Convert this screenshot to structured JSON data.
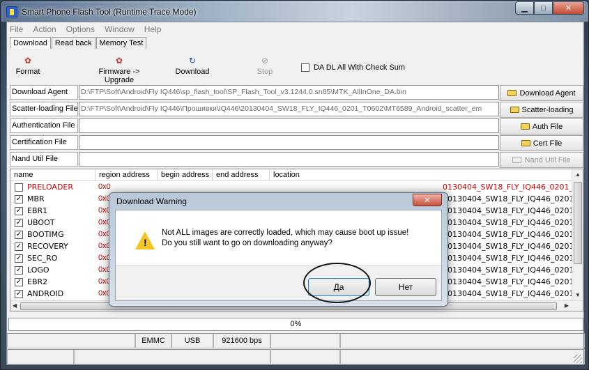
{
  "window": {
    "title": "Smart Phone Flash Tool (Runtime Trace Mode)"
  },
  "menu": [
    "File",
    "Action",
    "Options",
    "Window",
    "Help"
  ],
  "tabs": [
    "Download",
    "Read back",
    "Memory Test"
  ],
  "toolbar": {
    "format": "Format",
    "firmware_upgrade": "Firmware -> Upgrade",
    "download": "Download",
    "stop": "Stop",
    "checksum": "DA DL All With Check Sum"
  },
  "fields": [
    {
      "label": "Download Agent",
      "value": "D:\\FTP\\Soft\\Android\\Fly IQ446\\sp_flash_tool\\SP_Flash_Tool_v3.1244.0.sn85\\MTK_AllInOne_DA.bin",
      "button": "Download Agent"
    },
    {
      "label": "Scatter-loading File",
      "value": "D:\\FTP\\Soft\\Android\\Fly IQ446\\Прошивки\\IQ446\\20130404_SW18_FLY_IQ446_0201_T0602\\MT6589_Android_scatter_em",
      "button": "Scatter-loading"
    },
    {
      "label": "Authentication File",
      "value": "",
      "button": "Auth File"
    },
    {
      "label": "Certification File",
      "value": "",
      "button": "Cert File"
    },
    {
      "label": "Nand Util File",
      "value": "",
      "button": "Nand Util File"
    }
  ],
  "table": {
    "columns": [
      "name",
      "region address",
      "begin address",
      "end address",
      "location"
    ],
    "rows": [
      {
        "name": "PRELOADER",
        "checked": false,
        "region": "0x0",
        "location": "0130404_SW18_FLY_IQ446_0201_"
      },
      {
        "name": "MBR",
        "checked": true,
        "region": "0x0",
        "location": "20130404_SW18_FLY_IQ446_0201_"
      },
      {
        "name": "EBR1",
        "checked": true,
        "region": "0x0",
        "location": "20130404_SW18_FLY_IQ446_0201_"
      },
      {
        "name": "UBOOT",
        "checked": true,
        "region": "0x0",
        "location": "20130404_SW18_FLY_IQ446_0201_"
      },
      {
        "name": "BOOTIMG",
        "checked": true,
        "region": "0x0",
        "location": "20130404_SW18_FLY_IQ446_0201_"
      },
      {
        "name": "RECOVERY",
        "checked": true,
        "region": "0x0",
        "location": "20130404_SW18_FLY_IQ446_0201_"
      },
      {
        "name": "SEC_RO",
        "checked": true,
        "region": "0x0",
        "location": "20130404_SW18_FLY_IQ446_0201_"
      },
      {
        "name": "LOGO",
        "checked": true,
        "region": "0x0",
        "location": "20130404_SW18_FLY_IQ446_0201_"
      },
      {
        "name": "EBR2",
        "checked": true,
        "region": "0x0",
        "location": "20130404_SW18_FLY_IQ446_0201_"
      },
      {
        "name": "ANDROID",
        "checked": true,
        "region": "0x0",
        "location": "20130404_SW18_FLY_IQ446_0201_"
      }
    ]
  },
  "progress": "0%",
  "status": [
    "EMMC",
    "USB",
    "921600 bps"
  ],
  "dialog": {
    "title": "Download Warning",
    "line1": "Not ALL images are correctly loaded, which may cause boot up issue!",
    "line2": "Do you still want to go on downloading anyway?",
    "yes": "Да",
    "no": "Нет"
  }
}
